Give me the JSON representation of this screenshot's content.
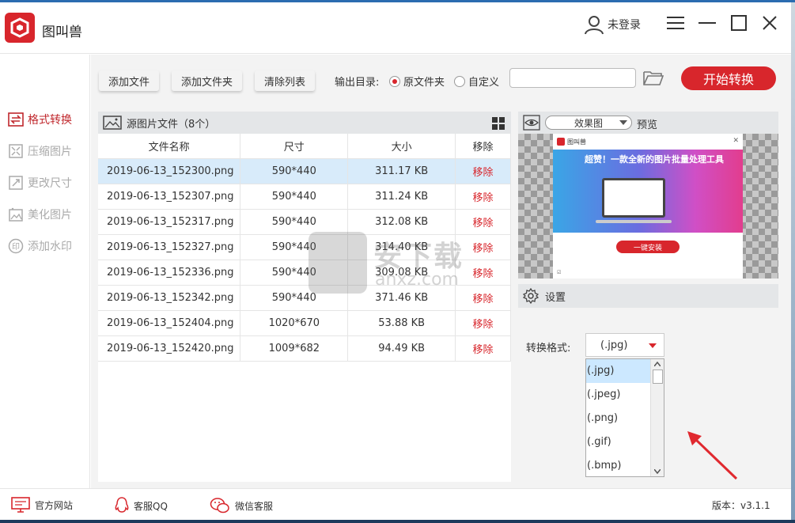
{
  "app": {
    "title": "图叫兽"
  },
  "user": {
    "login_status": "未登录"
  },
  "window_controls": {
    "menu": "menu-icon",
    "minimize": "minimize-icon",
    "maximize": "maximize-icon",
    "close": "close-icon"
  },
  "sidebar": {
    "items": [
      {
        "label": "格式转换",
        "icon": "convert-icon",
        "active": true
      },
      {
        "label": "压缩图片",
        "icon": "compress-icon",
        "active": false
      },
      {
        "label": "更改尺寸",
        "icon": "resize-icon",
        "active": false
      },
      {
        "label": "美化图片",
        "icon": "beautify-icon",
        "active": false
      },
      {
        "label": "添加水印",
        "icon": "watermark-icon",
        "active": false
      }
    ]
  },
  "toolbar": {
    "add_file": "添加文件",
    "add_folder": "添加文件夹",
    "clear_list": "清除列表",
    "output_label": "输出目录:",
    "radio_original": "原文件夹",
    "radio_custom": "自定义",
    "path_value": "",
    "start": "开始转换"
  },
  "file_panel": {
    "title": "源图片文件（8个）",
    "columns": [
      "文件名称",
      "尺寸",
      "大小",
      "移除"
    ],
    "rows": [
      {
        "name": "2019-06-13_152300.png",
        "size": "590*440",
        "filesize": "311.17 KB",
        "remove": "移除"
      },
      {
        "name": "2019-06-13_152307.png",
        "size": "590*440",
        "filesize": "311.24 KB",
        "remove": "移除"
      },
      {
        "name": "2019-06-13_152317.png",
        "size": "590*440",
        "filesize": "312.08 KB",
        "remove": "移除"
      },
      {
        "name": "2019-06-13_152327.png",
        "size": "590*440",
        "filesize": "314.40 KB",
        "remove": "移除"
      },
      {
        "name": "2019-06-13_152336.png",
        "size": "590*440",
        "filesize": "309.08 KB",
        "remove": "移除"
      },
      {
        "name": "2019-06-13_152342.png",
        "size": "590*440",
        "filesize": "371.46 KB",
        "remove": "移除"
      },
      {
        "name": "2019-06-13_152404.png",
        "size": "1020*670",
        "filesize": "53.88 KB",
        "remove": "移除"
      },
      {
        "name": "2019-06-13_152420.png",
        "size": "1009*682",
        "filesize": "94.49 KB",
        "remove": "移除"
      }
    ]
  },
  "preview": {
    "mode": "效果图",
    "label": "预览",
    "ad": {
      "brand": "图叫兽",
      "headline": "超赞！一款全新的图片批量处理工具",
      "install": "一键安装"
    }
  },
  "settings": {
    "title": "设置",
    "format_label": "转换格式:",
    "format_value": "(.jpg)",
    "options": [
      "(.jpg)",
      "(.jpeg)",
      "(.png)",
      "(.gif)",
      "(.bmp)"
    ]
  },
  "watermark": {
    "text": "安下载",
    "sub": "anxz.com"
  },
  "footer": {
    "website": "官方网站",
    "qq": "客服QQ",
    "wechat": "微信客服",
    "version": "版本：v3.1.1"
  },
  "colors": {
    "accent": "#d8262c",
    "selected_row": "#d8ebfa",
    "panel_header": "#e4e6e8"
  }
}
